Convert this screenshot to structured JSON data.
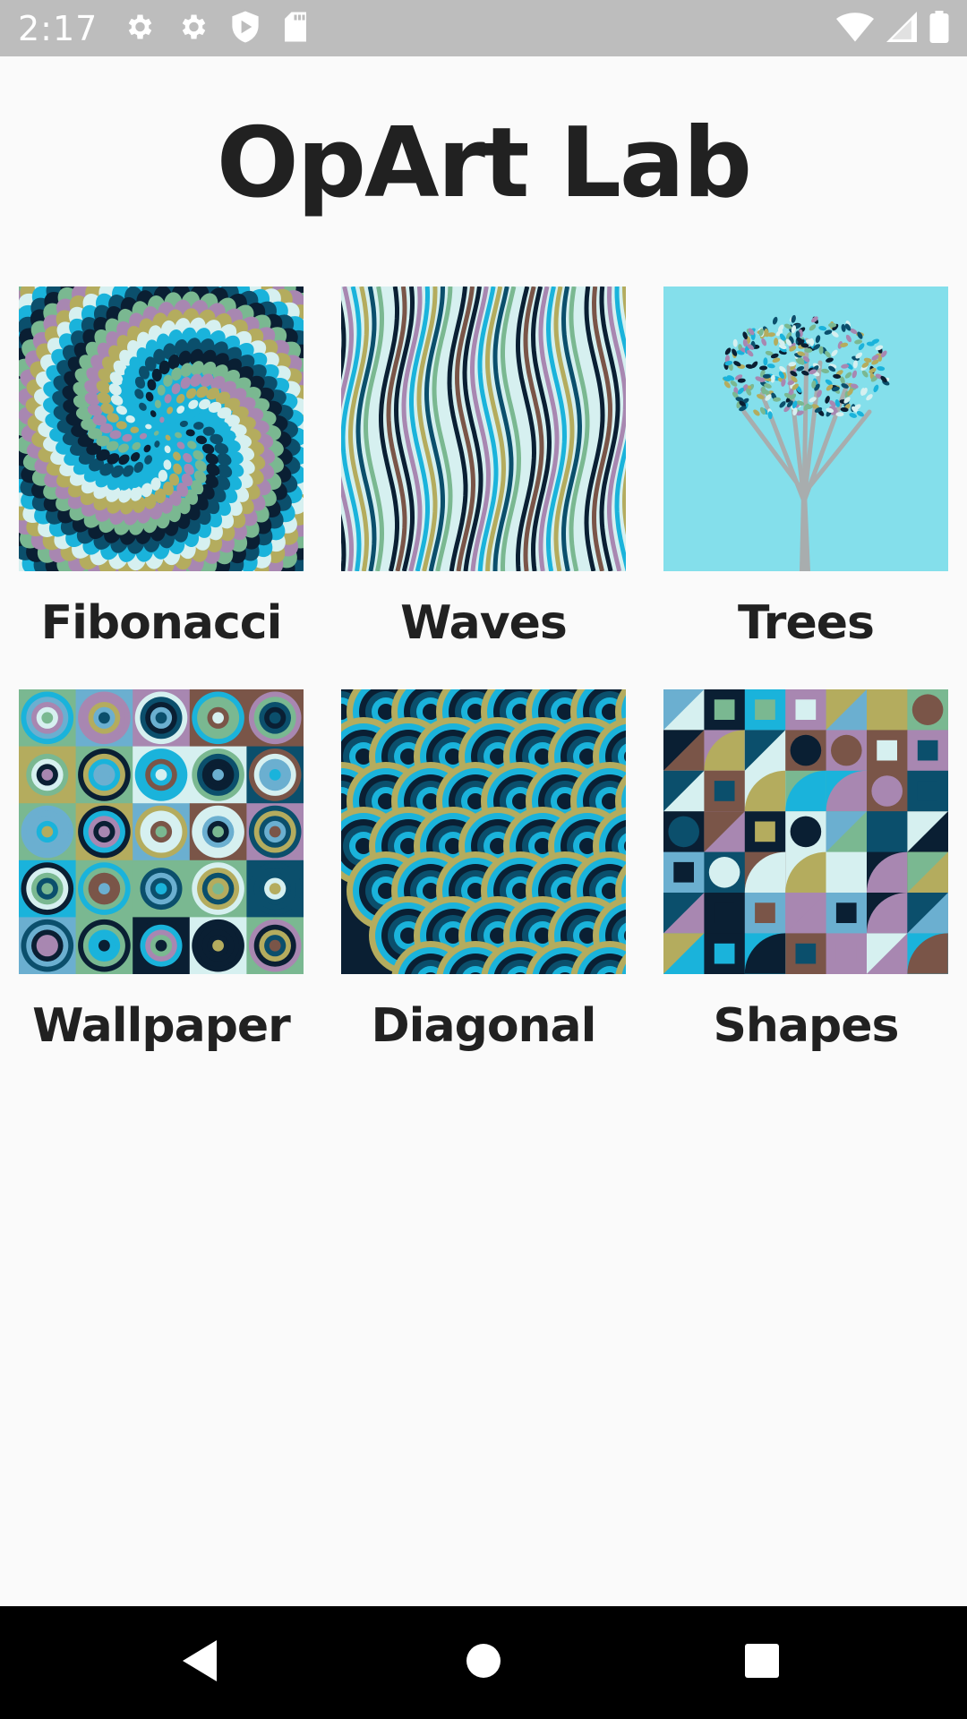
{
  "status_bar": {
    "time": "2:17"
  },
  "app": {
    "title": "OpArt Lab"
  },
  "gallery": {
    "items": [
      {
        "label": "Fibonacci"
      },
      {
        "label": "Waves"
      },
      {
        "label": "Trees"
      },
      {
        "label": "Wallpaper"
      },
      {
        "label": "Diagonal"
      },
      {
        "label": "Shapes"
      }
    ]
  },
  "palette": [
    "#0A1F33",
    "#1AB3DB",
    "#7AB891",
    "#A887B1",
    "#B4AC5E",
    "#D6F0F0",
    "#0B4F6C",
    "#7A5548",
    "#6BAFD0"
  ],
  "icons": {
    "status_left": [
      "gear-icon",
      "gear-icon",
      "shield-play-icon",
      "sd-card-icon"
    ],
    "status_right": [
      "wifi-icon",
      "signal-icon",
      "battery-icon"
    ],
    "nav": [
      "back-icon",
      "home-icon",
      "recents-icon"
    ]
  }
}
